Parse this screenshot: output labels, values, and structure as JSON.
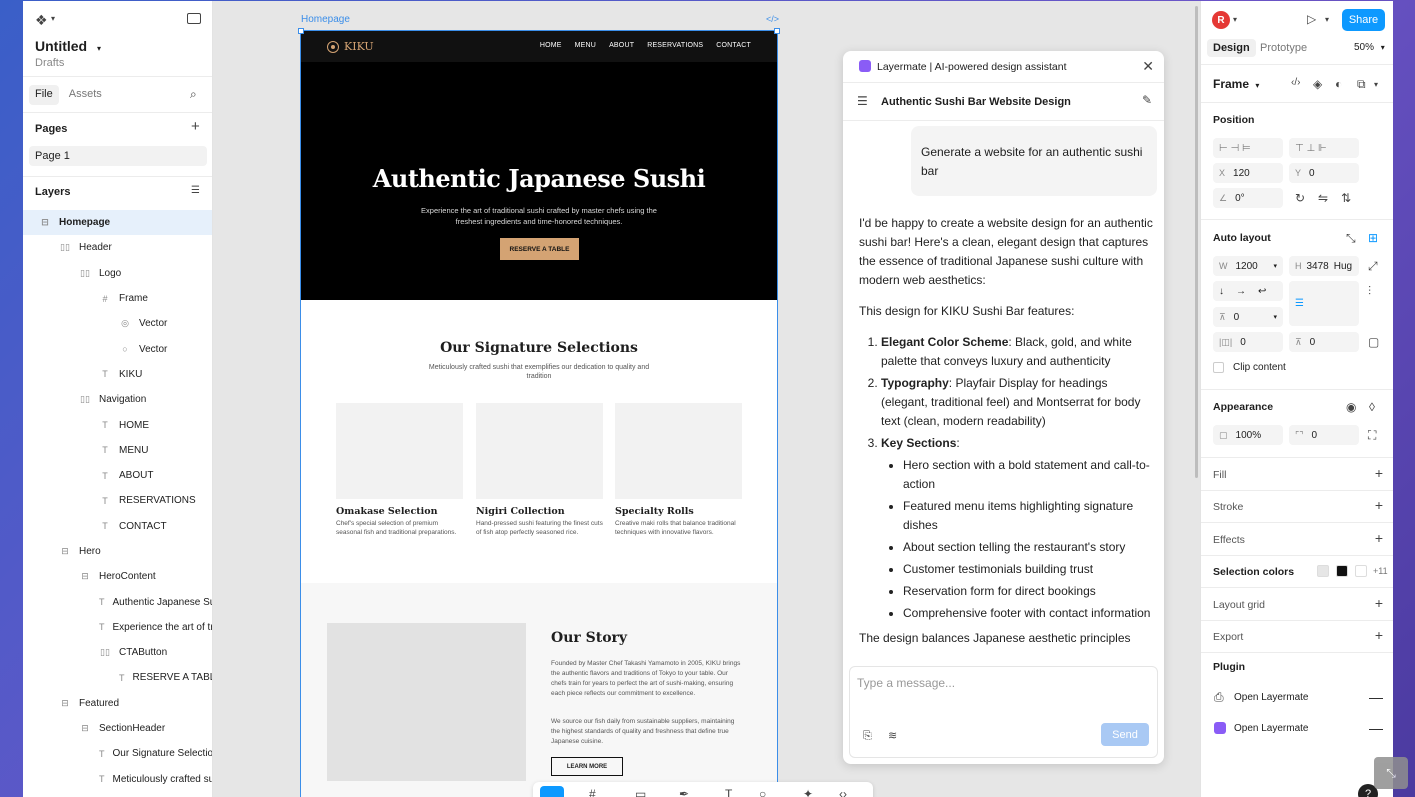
{
  "file": {
    "title": "Untitled",
    "location": "Drafts"
  },
  "sidebar": {
    "tabs": [
      "File",
      "Assets"
    ],
    "pages_label": "Pages",
    "page": "Page 1",
    "layers_label": "Layers",
    "layers": [
      {
        "label": "Homepage",
        "indent": 0,
        "icon": "frame-icon",
        "glyph": "⊟",
        "selected": true
      },
      {
        "label": "Header",
        "indent": 1,
        "icon": "auto-layout-icon",
        "glyph": "▯▯"
      },
      {
        "label": "Logo",
        "indent": 2,
        "icon": "auto-layout-icon",
        "glyph": "▯▯"
      },
      {
        "label": "Frame",
        "indent": 3,
        "icon": "hash-frame-icon",
        "glyph": "#"
      },
      {
        "label": "Vector",
        "indent": 4,
        "icon": "vector-icon",
        "glyph": "◎"
      },
      {
        "label": "Vector",
        "indent": 4,
        "icon": "vector-icon",
        "glyph": "○"
      },
      {
        "label": "KIKU",
        "indent": 3,
        "icon": "text-icon",
        "glyph": "T"
      },
      {
        "label": "Navigation",
        "indent": 2,
        "icon": "auto-layout-icon",
        "glyph": "▯▯"
      },
      {
        "label": "HOME",
        "indent": 3,
        "icon": "text-icon",
        "glyph": "T"
      },
      {
        "label": "MENU",
        "indent": 3,
        "icon": "text-icon",
        "glyph": "T"
      },
      {
        "label": "ABOUT",
        "indent": 3,
        "icon": "text-icon",
        "glyph": "T"
      },
      {
        "label": "RESERVATIONS",
        "indent": 3,
        "icon": "text-icon",
        "glyph": "T"
      },
      {
        "label": "CONTACT",
        "indent": 3,
        "icon": "text-icon",
        "glyph": "T"
      },
      {
        "label": "Hero",
        "indent": 1,
        "icon": "auto-layout-vertical-icon",
        "glyph": "⊟"
      },
      {
        "label": "HeroContent",
        "indent": 2,
        "icon": "auto-layout-vertical-icon",
        "glyph": "⊟"
      },
      {
        "label": "Authentic Japanese Sushi",
        "indent": 3,
        "icon": "text-icon",
        "glyph": "T"
      },
      {
        "label": "Experience the art of traditional sushi",
        "indent": 3,
        "icon": "text-icon",
        "glyph": "T"
      },
      {
        "label": "CTAButton",
        "indent": 3,
        "icon": "auto-layout-icon",
        "glyph": "▯▯"
      },
      {
        "label": "RESERVE A TABLE",
        "indent": 4,
        "icon": "text-icon",
        "glyph": "T"
      },
      {
        "label": "Featured",
        "indent": 1,
        "icon": "auto-layout-vertical-icon",
        "glyph": "⊟"
      },
      {
        "label": "SectionHeader",
        "indent": 2,
        "icon": "auto-layout-vertical-icon",
        "glyph": "⊟"
      },
      {
        "label": "Our Signature Selections",
        "indent": 3,
        "icon": "text-icon",
        "glyph": "T"
      },
      {
        "label": "Meticulously crafted sushi",
        "indent": 3,
        "icon": "text-icon",
        "glyph": "T"
      }
    ]
  },
  "canvas": {
    "frame_label": "Homepage",
    "frame_code_icon": "</>",
    "site": {
      "logo_text": "KIKU",
      "nav": [
        "HOME",
        "MENU",
        "ABOUT",
        "RESERVATIONS",
        "CONTACT"
      ],
      "hero_title": "Authentic Japanese Sushi",
      "hero_text": "Experience the art of traditional sushi crafted by master chefs using the freshest ingredients and time-honored techniques.",
      "hero_cta": "RESERVE A TABLE",
      "featured_title": "Our Signature Selections",
      "featured_sub": "Meticulously crafted sushi that exemplifies our dedication to quality and tradition",
      "cards": [
        {
          "title": "Omakase Selection",
          "text": "Chef's special selection of premium seasonal fish and traditional preparations."
        },
        {
          "title": "Nigiri Collection",
          "text": "Hand-pressed sushi featuring the finest cuts of fish atop perfectly seasoned rice."
        },
        {
          "title": "Specialty Rolls",
          "text": "Creative maki rolls that balance traditional techniques with innovative flavors."
        }
      ],
      "story_title": "Our Story",
      "story_p1": "Founded by Master Chef Takashi Yamamoto in 2005, KIKU brings the authentic flavors and traditions of Tokyo to your table. Our chefs train for years to perfect the art of sushi-making, ensuring each piece reflects our commitment to excellence.",
      "story_p2": "We source our fish daily from sustainable suppliers, maintaining the highest standards of quality and freshness that define true Japanese cuisine.",
      "story_cta": "LEARN MORE"
    }
  },
  "assistant": {
    "title": "Layermate | AI-powered design assistant",
    "subtitle": "Authentic Sushi Bar Website Design",
    "user_msg": "Generate a website for an authentic sushi bar",
    "intro": "I'd be happy to create a website design for an authentic sushi bar! Here's a clean, elegant design that captures the essence of traditional Japanese sushi culture with modern web aesthetics:",
    "features_lead": "This design for KIKU Sushi Bar features:",
    "points": [
      {
        "bold": "Elegant Color Scheme",
        "rest": ": Black, gold, and white palette that conveys luxury and authenticity"
      },
      {
        "bold": "Typography",
        "rest": ": Playfair Display for headings (elegant, traditional feel) and Montserrat for body text (clean, modern readability)"
      },
      {
        "bold": "Key Sections",
        "rest": ":"
      }
    ],
    "sections": [
      "Hero section with a bold statement and call-to-action",
      "Featured menu items highlighting signature dishes",
      "About section telling the restaurant's story",
      "Customer testimonials building trust",
      "Reservation form for direct bookings",
      "Comprehensive footer with contact information"
    ],
    "outro": "The design balances Japanese aesthetic principles",
    "input_placeholder": "Type a message...",
    "send_label": "Send"
  },
  "rightpanel": {
    "avatar": "R",
    "share": "Share",
    "tabs": [
      "Design",
      "Prototype"
    ],
    "zoom": "50%",
    "frame_dropdown": "Frame",
    "position_label": "Position",
    "x_label": "X",
    "x_value": "120",
    "y_label": "Y",
    "y_value": "0",
    "rotation": "0°",
    "autolayout_label": "Auto layout",
    "w_label": "W",
    "w_value": "1200",
    "h_label": "H",
    "h_value": "3478",
    "h_mode": "Hug",
    "gap_value": "0",
    "pad_h": "0",
    "pad_v": "0",
    "clip_label": "Clip content",
    "appearance_label": "Appearance",
    "opacity": "100%",
    "radius": "0",
    "fill_label": "Fill",
    "stroke_label": "Stroke",
    "effects_label": "Effects",
    "selcolors_label": "Selection colors",
    "selcolors_more": "+11",
    "selcolors": [
      "#e6e6e6",
      "#111111",
      "#ffffff"
    ],
    "layoutgrid_label": "Layout grid",
    "export_label": "Export",
    "plugin_label": "Plugin",
    "plugins": [
      "Open Layermate",
      "Open Layermate"
    ]
  },
  "colors": {
    "accent": "#0d99ff",
    "selection": "#3b8ee9",
    "gold": "#d4a373"
  }
}
